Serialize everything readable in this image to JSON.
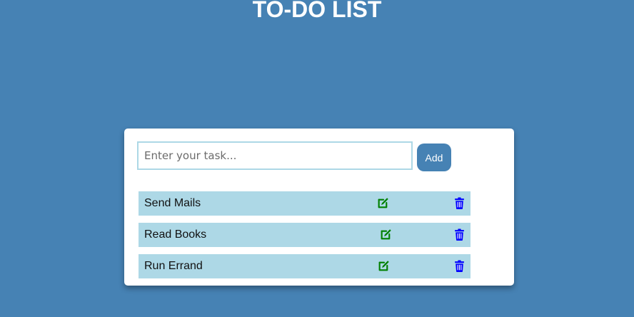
{
  "header": {
    "title": "TO-DO LIST"
  },
  "input": {
    "placeholder": "Enter your task...",
    "value": ""
  },
  "add_button": {
    "label": "Add"
  },
  "tasks": [
    {
      "label": "Send Mails",
      "edit_icon": "edit-icon",
      "delete_icon": "trash-icon"
    },
    {
      "label": "Read Books",
      "edit_icon": "edit-icon",
      "delete_icon": "trash-icon"
    },
    {
      "label": "Run Errand",
      "edit_icon": "edit-icon",
      "delete_icon": "trash-icon"
    }
  ],
  "colors": {
    "background": "#4682b4",
    "task_bg": "#add8e6",
    "edit_icon": "#008000",
    "delete_icon": "#0000ff",
    "add_button_bg": "#4682b4"
  }
}
